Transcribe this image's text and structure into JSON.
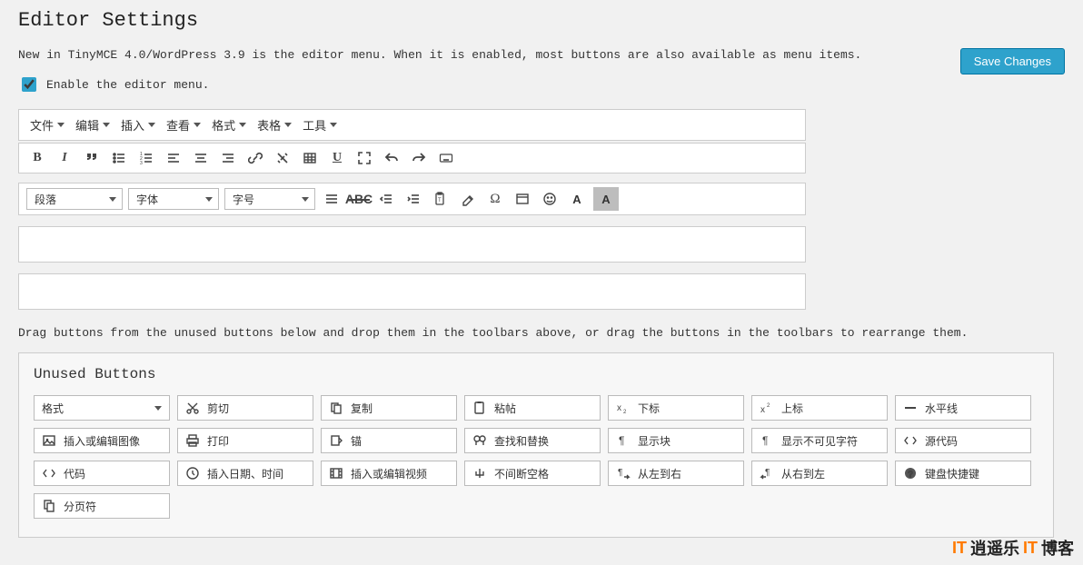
{
  "page": {
    "title": "Editor Settings",
    "intro": "New in TinyMCE 4.0/WordPress 3.9 is the editor menu. When it is enabled, most buttons are also available as menu items.",
    "save_button": "Save Changes",
    "enable_menu_label": "Enable the editor menu.",
    "drag_hint": "Drag buttons from the unused buttons below and drop them in the toolbars above, or drag the buttons in the toolbars to rearrange them."
  },
  "menubar": [
    {
      "label": "文件"
    },
    {
      "label": "编辑"
    },
    {
      "label": "插入"
    },
    {
      "label": "查看"
    },
    {
      "label": "格式"
    },
    {
      "label": "表格"
    },
    {
      "label": "工具"
    }
  ],
  "toolbar1_icons": [
    "bold",
    "italic",
    "blockquote",
    "bullist",
    "numlist",
    "alignleft",
    "aligncenter",
    "alignright",
    "link",
    "unlink",
    "table",
    "underline",
    "fullscreen",
    "undo",
    "redo",
    "keyboard"
  ],
  "toolbar2": {
    "paragraph_label": "段落",
    "font_label": "字体",
    "size_label": "字号"
  },
  "toolbar2_icons": [
    "alignjustify",
    "strike",
    "outdent",
    "indent",
    "paste",
    "eraser",
    "omega",
    "hr",
    "smiley"
  ],
  "unused": {
    "heading": "Unused Buttons",
    "items": [
      {
        "label": "格式",
        "icon": null,
        "dropdown": true
      },
      {
        "label": "剪切",
        "icon": "cut"
      },
      {
        "label": "复制",
        "icon": "copy"
      },
      {
        "label": "粘帖",
        "icon": "paste"
      },
      {
        "label": "下标",
        "icon": "sub"
      },
      {
        "label": "上标",
        "icon": "sup"
      },
      {
        "label": "水平线",
        "icon": "hr"
      },
      {
        "label": "插入或编辑图像",
        "icon": "image"
      },
      {
        "label": "打印",
        "icon": "print"
      },
      {
        "label": "锚",
        "icon": "anchor"
      },
      {
        "label": "查找和替换",
        "icon": "search"
      },
      {
        "label": "显示块",
        "icon": "blocks"
      },
      {
        "label": "显示不可见字符",
        "icon": "pilcrow"
      },
      {
        "label": "源代码",
        "icon": "code"
      },
      {
        "label": "代码",
        "icon": "codein"
      },
      {
        "label": "插入日期、时间",
        "icon": "clock"
      },
      {
        "label": "插入或编辑视频",
        "icon": "video"
      },
      {
        "label": "不间断空格",
        "icon": "nbsp"
      },
      {
        "label": "从左到右",
        "icon": "ltr"
      },
      {
        "label": "从右到左",
        "icon": "rtl"
      },
      {
        "label": "键盘快捷键",
        "icon": "help"
      },
      {
        "label": "分页符",
        "icon": "pagebreak"
      }
    ]
  },
  "watermark": {
    "brand_a": "IT",
    "brand_b": "逍遥乐",
    "brand_c": "IT",
    "brand_d": "博客"
  }
}
